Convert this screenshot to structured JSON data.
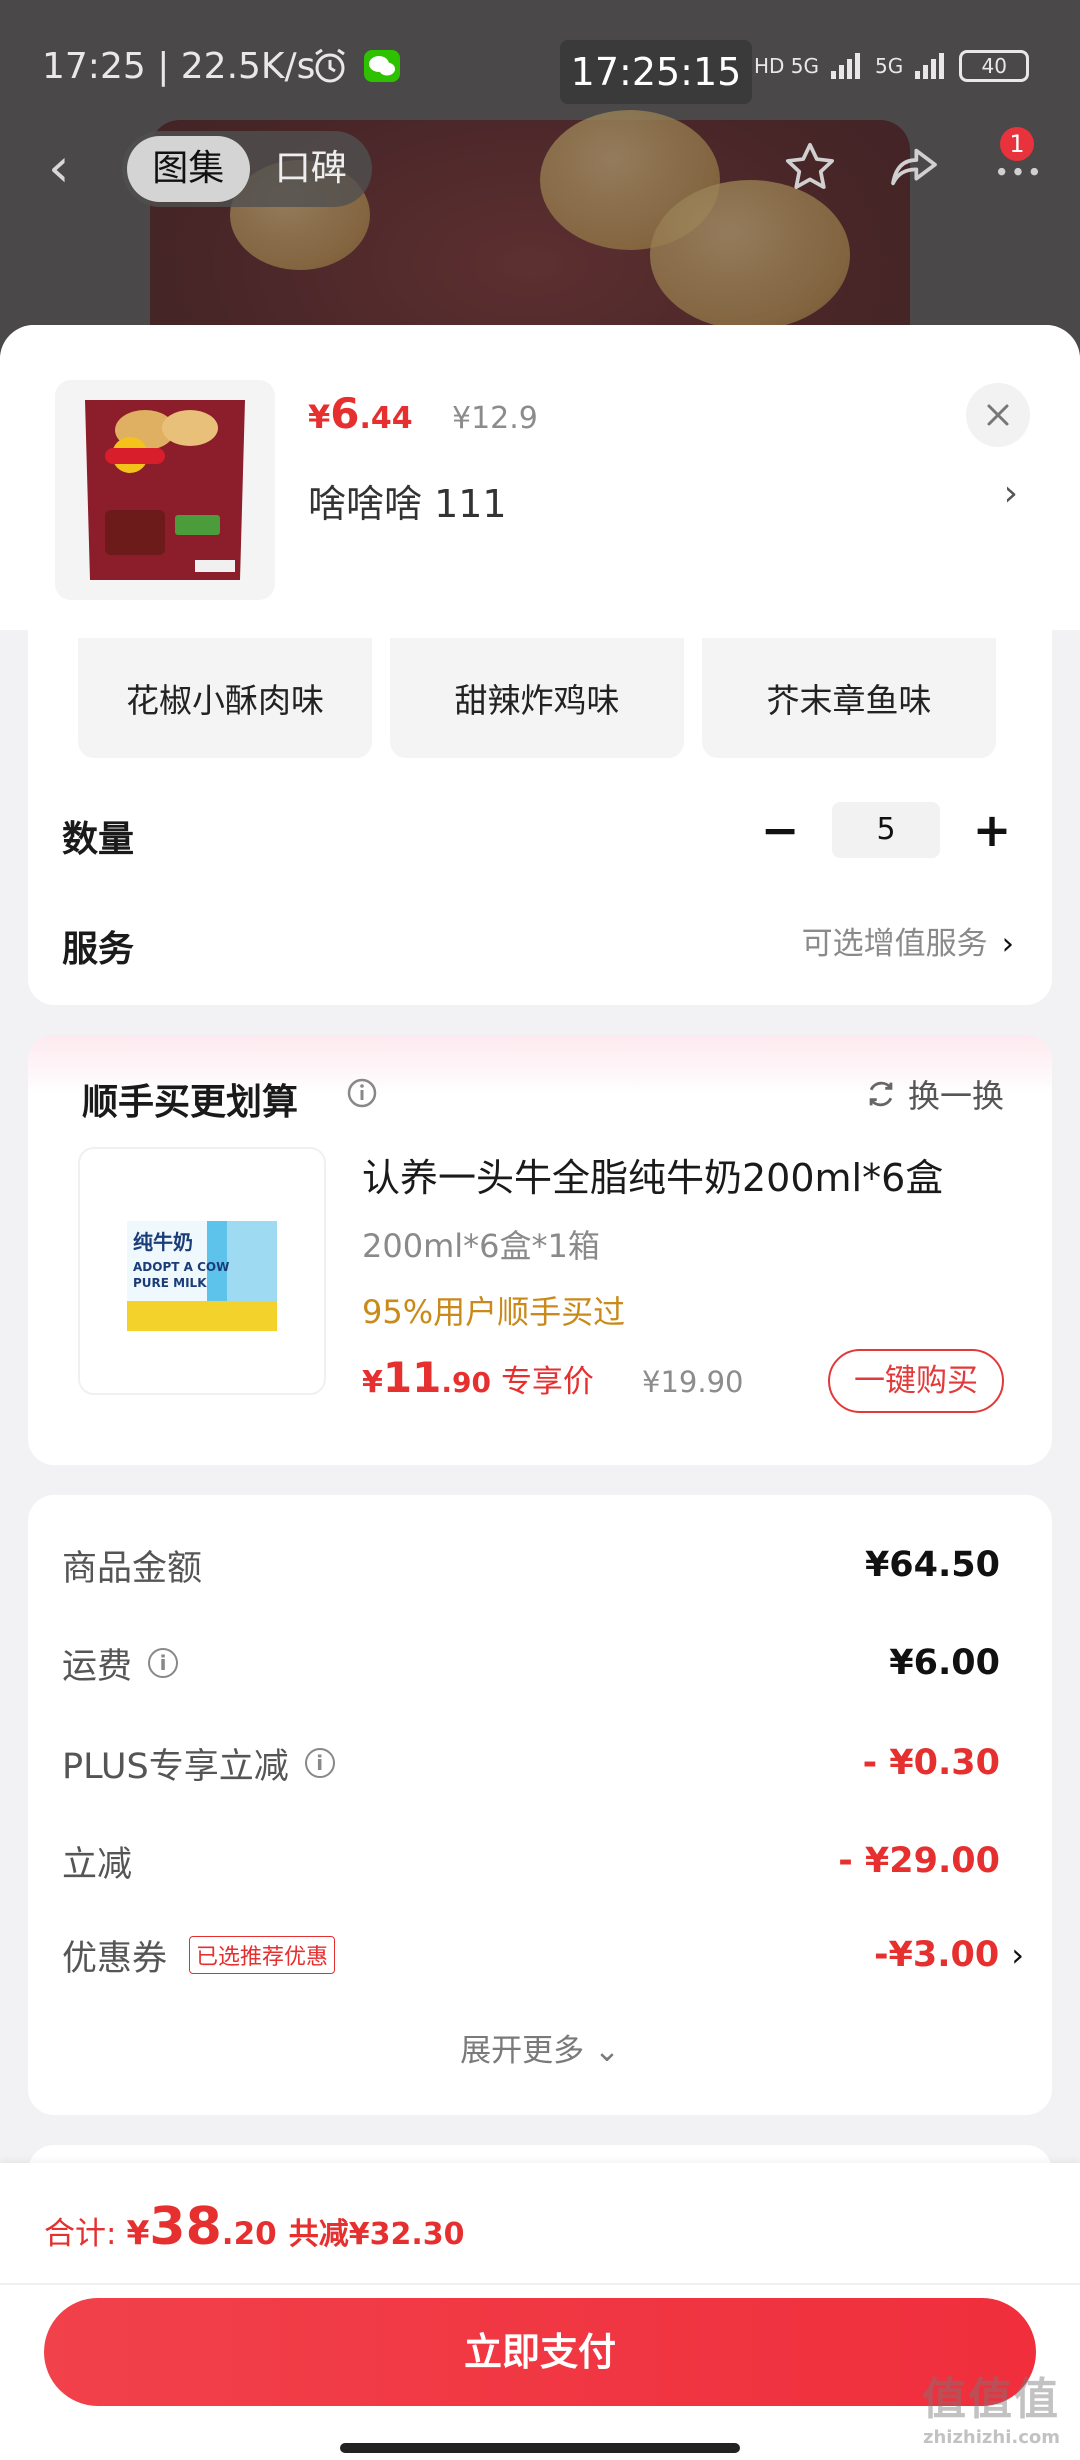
{
  "status_bar": {
    "time": "17:25 | 22.5K/s",
    "center_time": "17:25:15",
    "signal1": "HD 5G",
    "signal2": "5G",
    "battery": "40"
  },
  "nav": {
    "tabs": [
      "图集",
      "口碑"
    ],
    "badge_count": "1"
  },
  "product": {
    "price_symbol": "¥",
    "price_int": "6",
    "price_dec": ".44",
    "original_price": "¥12.9",
    "sku": "啥啥啥  111",
    "flavors": [
      "花椒小酥肉味",
      "甜辣炸鸡味",
      "芥末章鱼味"
    ],
    "quantity_label": "数量",
    "quantity": "5",
    "service_label": "服务",
    "service_hint": "可选增值服务"
  },
  "addon": {
    "title": "顺手买更划算",
    "swap_label": "换一换",
    "item_title": "认养一头牛全脂纯牛奶200ml*6盒",
    "item_spec": "200ml*6盒*1箱",
    "social_proof": "95%用户顺手买过",
    "price_symbol": "¥",
    "price_int": "11",
    "price_dec": ".90",
    "exclusive_label": "专享价",
    "original_price": "¥19.90",
    "buy_label": "一键购买",
    "image_text_cn": "纯牛奶",
    "image_text_en1": "ADOPT A COW",
    "image_text_en2": "PURE MILK"
  },
  "fees": {
    "rows": [
      {
        "label": "商品金额",
        "value": "¥64.50"
      },
      {
        "label": "运费",
        "value": "¥6.00"
      },
      {
        "label": "PLUS专享立减",
        "value": "- ¥0.30"
      },
      {
        "label": "立减",
        "value": "- ¥29.00"
      },
      {
        "label": "优惠券",
        "tag": "已选推荐优惠",
        "value": "-¥3.00"
      }
    ],
    "expand_label": "展开更多"
  },
  "footer": {
    "total_label": "合计:",
    "total_symbol": "¥",
    "total_int": "38",
    "total_dec": ".20",
    "saved": "共减¥32.30",
    "pay_label": "立即支付",
    "watermark_big": "值值值",
    "watermark_small": "zhizhizhi.com"
  },
  "colors": {
    "accent_red": "#e62f2f",
    "social_gold": "#c98a1a"
  }
}
